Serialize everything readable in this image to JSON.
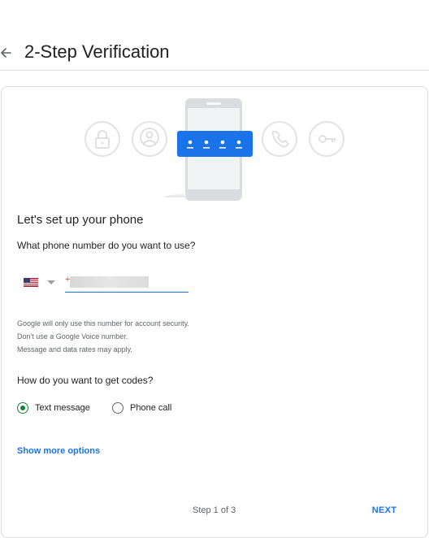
{
  "header": {
    "title": "2-Step Verification"
  },
  "illustration": {
    "password_dots": "• • • •",
    "icons": [
      "lock-icon",
      "person-icon",
      "phone-icon",
      "key-icon"
    ]
  },
  "setup": {
    "title": "Let's set up your phone",
    "question": "What phone number do you want to use?",
    "country_flag": "us-flag-icon",
    "phone_prefix": "+"
  },
  "notes": [
    "Google will only use this number for account security.",
    "Don't use a Google Voice number.",
    "Message and data rates may apply."
  ],
  "codes": {
    "question": "How do you want to get codes?",
    "options": [
      {
        "label": "Text message",
        "selected": true
      },
      {
        "label": "Phone call",
        "selected": false
      }
    ]
  },
  "links": {
    "show_more": "Show more options"
  },
  "footer": {
    "step": "Step 1 of 3",
    "next": "NEXT"
  },
  "colors": {
    "accent": "#1a73e8",
    "radio_selected": "#188038",
    "divider": "#dadce0"
  }
}
